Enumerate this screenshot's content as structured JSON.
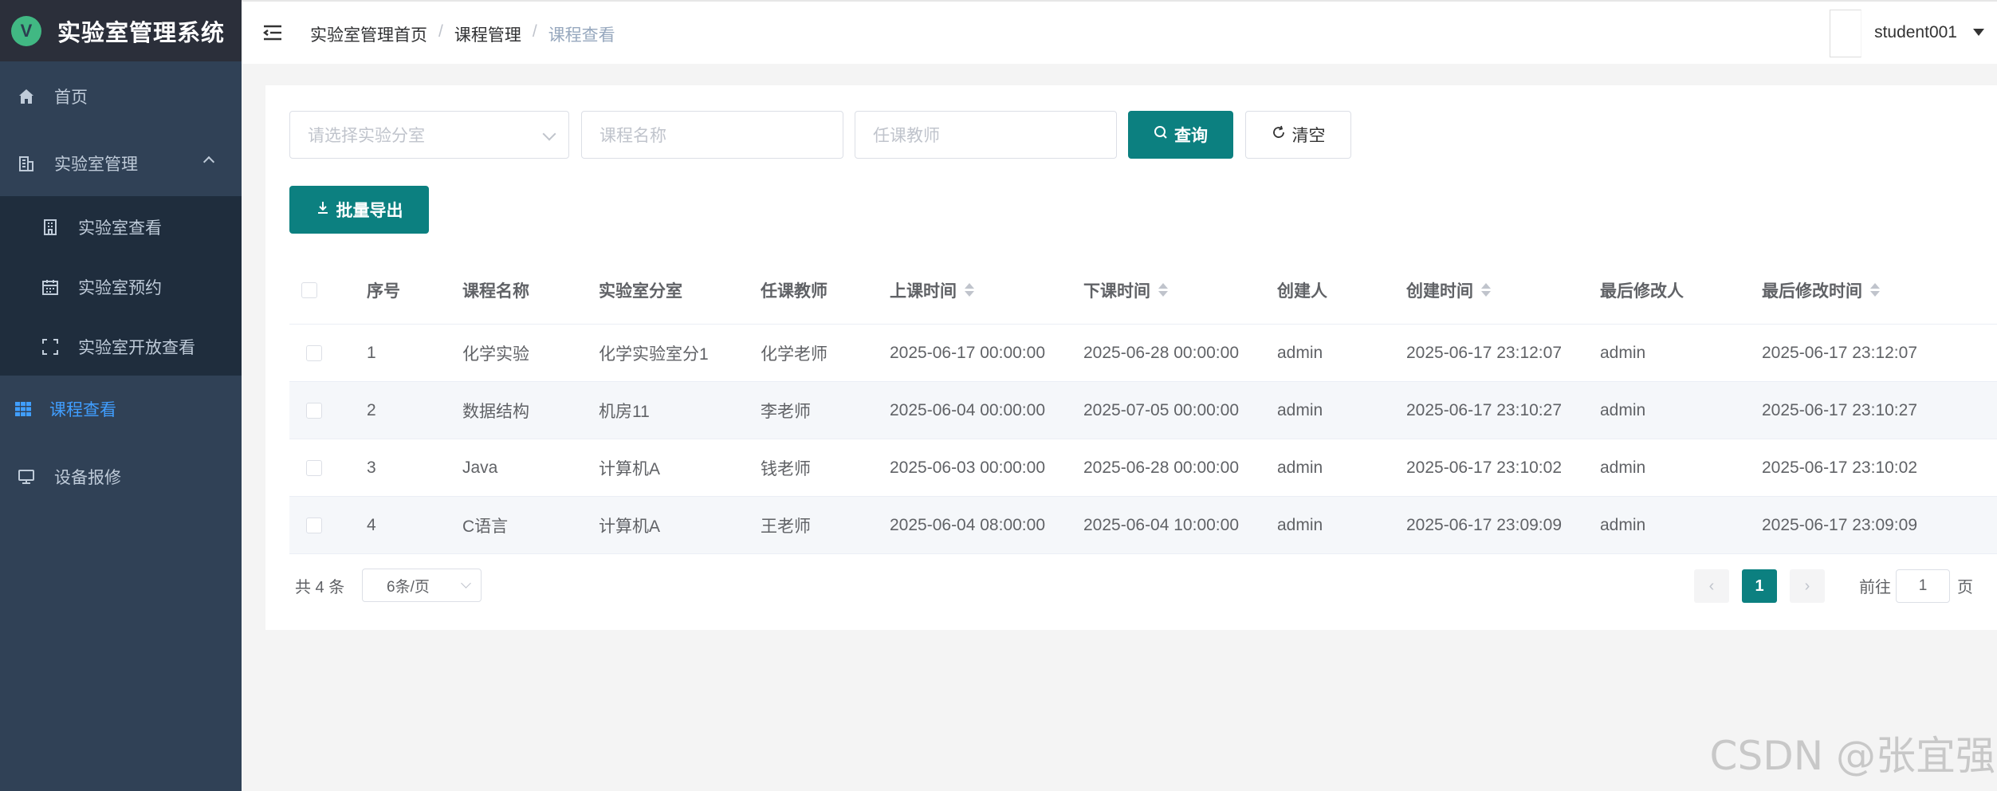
{
  "app": {
    "title": "实验室管理系统",
    "logo_letter": "V"
  },
  "sidebar": {
    "items": [
      {
        "label": "首页",
        "icon": "home-icon"
      },
      {
        "label": "实验室管理",
        "icon": "building-icon"
      },
      {
        "label": "实验室查看",
        "icon": "office-icon"
      },
      {
        "label": "实验室预约",
        "icon": "calendar-icon"
      },
      {
        "label": "实验室开放查看",
        "icon": "fullscreen-icon"
      },
      {
        "label": "课程查看",
        "icon": "grid-icon"
      },
      {
        "label": "设备报修",
        "icon": "monitor-icon"
      }
    ]
  },
  "header": {
    "breadcrumb": [
      "实验室管理首页",
      "课程管理",
      "课程查看"
    ],
    "username": "student001"
  },
  "search": {
    "lab_placeholder": "请选择实验分室",
    "course_placeholder": "课程名称",
    "teacher_placeholder": "任课教师",
    "query_label": "查询",
    "clear_label": "清空",
    "export_label": "批量导出"
  },
  "table": {
    "columns": [
      "序号",
      "课程名称",
      "实验室分室",
      "任课教师",
      "上课时间",
      "下课时间",
      "创建人",
      "创建时间",
      "最后修改人",
      "最后修改时间"
    ],
    "rows": [
      [
        "1",
        "化学实验",
        "化学实验室分1",
        "化学老师",
        "2025-06-17 00:00:00",
        "2025-06-28 00:00:00",
        "admin",
        "2025-06-17 23:12:07",
        "admin",
        "2025-06-17 23:12:07"
      ],
      [
        "2",
        "数据结构",
        "机房11",
        "李老师",
        "2025-06-04 00:00:00",
        "2025-07-05 00:00:00",
        "admin",
        "2025-06-17 23:10:27",
        "admin",
        "2025-06-17 23:10:27"
      ],
      [
        "3",
        "Java",
        "计算机A",
        "钱老师",
        "2025-06-03 00:00:00",
        "2025-06-28 00:00:00",
        "admin",
        "2025-06-17 23:10:02",
        "admin",
        "2025-06-17 23:10:02"
      ],
      [
        "4",
        "C语言",
        "计算机A",
        "王老师",
        "2025-06-04 08:00:00",
        "2025-06-04 10:00:00",
        "admin",
        "2025-06-17 23:09:09",
        "admin",
        "2025-06-17 23:09:09"
      ]
    ]
  },
  "pagination": {
    "total": "共 4 条",
    "page_size": "6条/页",
    "current_page": "1",
    "goto_label": "前往",
    "goto_value": "1",
    "page_suffix": "页"
  },
  "watermark": "CSDN @张宜强",
  "colors": {
    "primary": "#0c8080",
    "sidebar": "#304156",
    "active_menu": "#409eff"
  }
}
